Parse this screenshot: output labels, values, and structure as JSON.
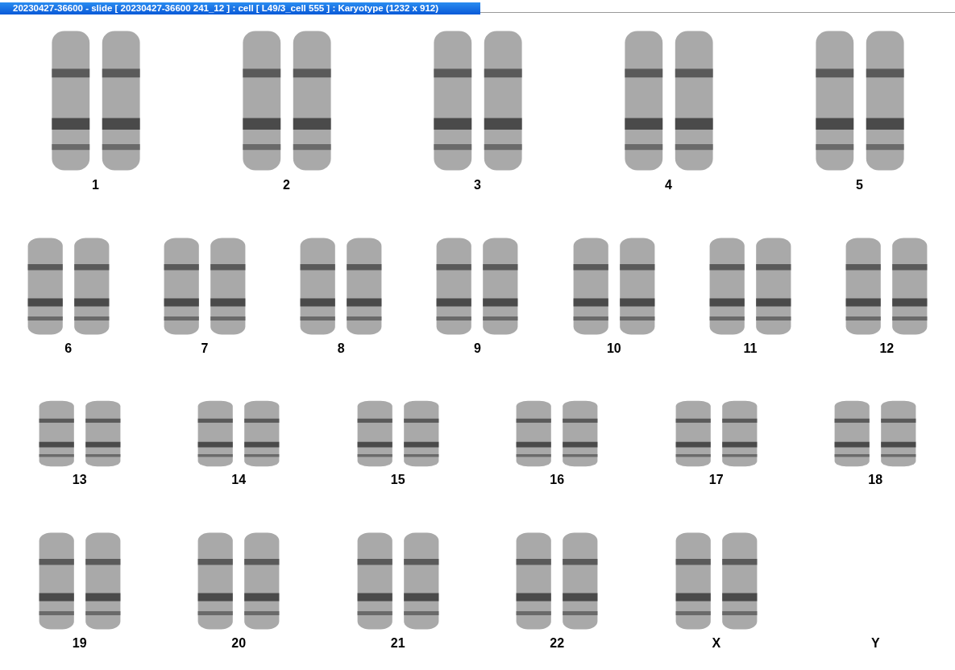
{
  "window": {
    "title": "20230427-36600 - slide [ 20230427-36600 241_12 ] : cell [ L49/3_cell 555 ] : Karyotype  (1232 x 912)"
  },
  "karyotype_rows": [
    {
      "items": [
        {
          "label": "1",
          "kind": "pair"
        },
        {
          "label": "2",
          "kind": "pair"
        },
        {
          "label": "3",
          "kind": "pair"
        },
        {
          "label": "4",
          "kind": "pair"
        },
        {
          "label": "5",
          "kind": "pair"
        }
      ]
    },
    {
      "items": [
        {
          "label": "6",
          "kind": "pair"
        },
        {
          "label": "7",
          "kind": "pair"
        },
        {
          "label": "8",
          "kind": "pair"
        },
        {
          "label": "9",
          "kind": "pair"
        },
        {
          "label": "10",
          "kind": "pair"
        },
        {
          "label": "11",
          "kind": "pair"
        },
        {
          "label": "12",
          "kind": "pair"
        }
      ]
    },
    {
      "items": [
        {
          "label": "13",
          "kind": "pair"
        },
        {
          "label": "14",
          "kind": "pair"
        },
        {
          "label": "15",
          "kind": "pair"
        },
        {
          "label": "16",
          "kind": "pair"
        },
        {
          "label": "17",
          "kind": "pair"
        },
        {
          "label": "18",
          "kind": "pair"
        }
      ]
    },
    {
      "items": [
        {
          "label": "19",
          "kind": "pair"
        },
        {
          "label": "20",
          "kind": "pair"
        },
        {
          "label": "21",
          "kind": "pair"
        },
        {
          "label": "22",
          "kind": "pair"
        },
        {
          "label": "X",
          "kind": "pair"
        },
        {
          "label": "Y",
          "kind": "empty"
        }
      ]
    }
  ]
}
